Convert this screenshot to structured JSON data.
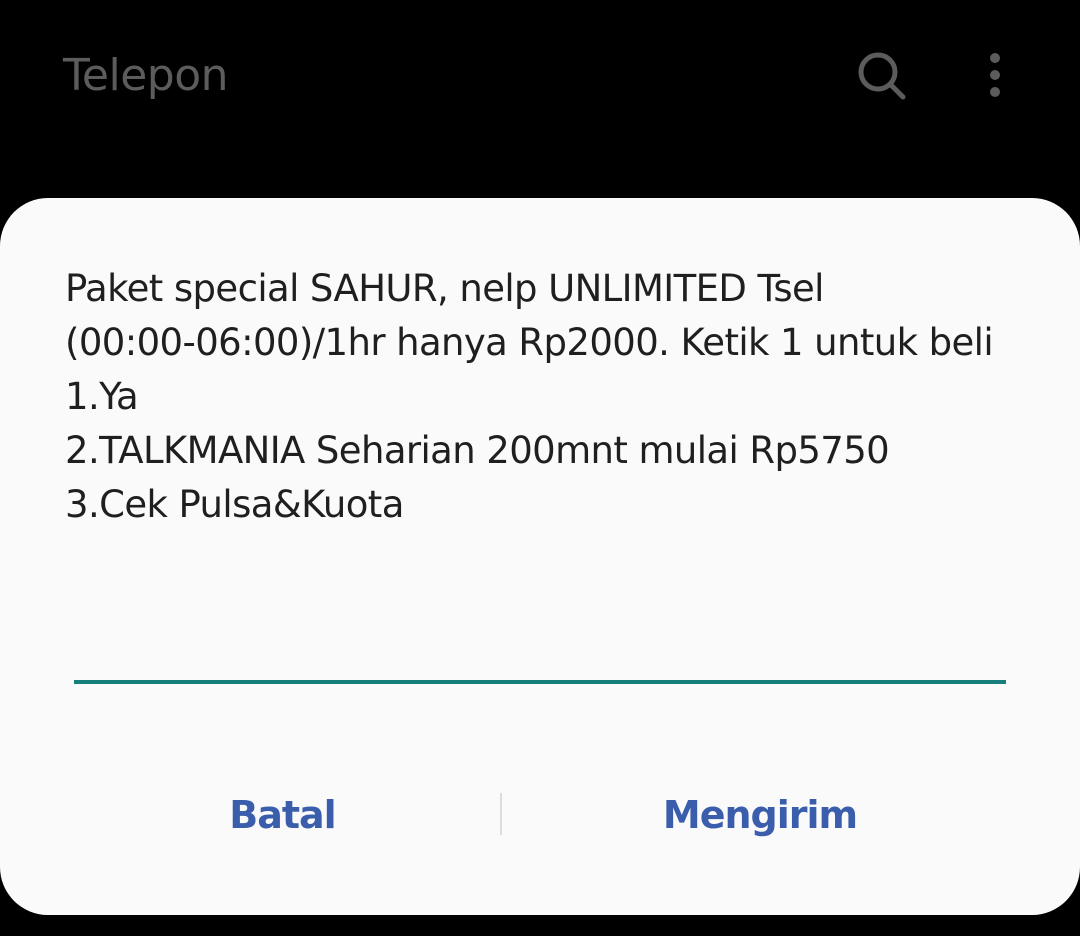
{
  "app_bar": {
    "title": "Telepon",
    "search_icon": "search-icon",
    "more_icon": "more-vertical-icon"
  },
  "dialog": {
    "message_lines": [
      "Paket special SAHUR, nelp UNLIMITED Tsel",
      "(00:00-06:00)/1hr hanya Rp2000. Ketik 1 untuk beli",
      "1.Ya",
      "2.TALKMANIA Seharian 200mnt mulai Rp5750",
      "3.Cek Pulsa&Kuota"
    ],
    "input_value": "",
    "cancel_label": "Batal",
    "send_label": "Mengirim"
  },
  "colors": {
    "background": "#000000",
    "dialog_background": "#fafafa",
    "accent_underline": "#167f7b",
    "button_text": "#3a5dac",
    "title_text": "#5c5c5c"
  }
}
